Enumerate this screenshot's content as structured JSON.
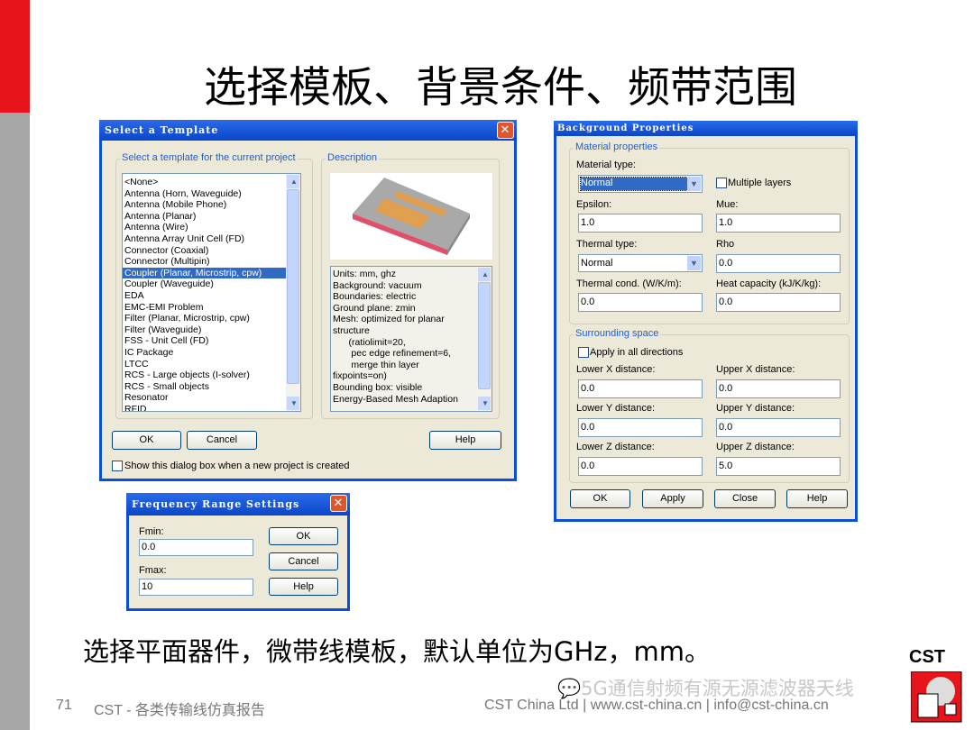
{
  "slide": {
    "title": "选择模板、背景条件、频带范围",
    "subtitle": "选择平面器件，微带线模板，默认单位为GHz，mm。",
    "page_number": "71",
    "footer_left": "CST - 各类传输线仿真报告",
    "footer_right": "CST China Ltd | www.cst-china.cn | info@cst-china.cn",
    "watermark": "5G通信射频有源无源滤波器天线",
    "logo": "CST",
    "accent_red": "#e8141c",
    "side_grey": "#a6a6a6"
  },
  "template_dialog": {
    "title": "Select a Template",
    "list_group": "Select a template for the current project",
    "items": [
      "<None>",
      "Antenna (Horn, Waveguide)",
      "Antenna (Mobile Phone)",
      "Antenna (Planar)",
      "Antenna (Wire)",
      "Antenna Array Unit Cell (FD)",
      "Connector (Coaxial)",
      "Connector (Multipin)",
      "Coupler (Planar, Microstrip, cpw)",
      "Coupler (Waveguide)",
      "EDA",
      "EMC-EMI Problem",
      "Filter (Planar, Microstrip, cpw)",
      "Filter (Waveguide)",
      "FSS - Unit Cell (FD)",
      "IC Package",
      "LTCC",
      "RCS - Large objects (I-solver)",
      "RCS - Small objects",
      "Resonator",
      "RFID"
    ],
    "selected": "Coupler (Planar, Microstrip, cpw)",
    "description_group": "Description",
    "description_lines": [
      "Units: mm, ghz",
      "Background: vacuum",
      "Boundaries: electric",
      "Ground plane: zmin",
      "Mesh: optimized for planar",
      "structure",
      "      (ratiolimit=20,",
      "       pec edge refinement=6,",
      "       merge thin layer",
      "fixpoints=on)",
      "Bounding box: visible",
      "Energy-Based Mesh Adaption"
    ],
    "ok": "OK",
    "cancel": "Cancel",
    "help": "Help",
    "show_checkbox": "Show this dialog box when a new project is created",
    "show_checked": false
  },
  "background_dialog": {
    "title": "Background Properties",
    "material_group": "Material properties",
    "material_type_label": "Material type:",
    "material_type": "Normal",
    "multiple_layers": "Multiple layers",
    "epsilon_label": "Epsilon:",
    "epsilon": "1.0",
    "mue_label": "Mue:",
    "mue": "1.0",
    "thermal_type_label": "Thermal type:",
    "thermal_type": "Normal",
    "rho_label": "Rho",
    "rho": "0.0",
    "thermal_cond_label": "Thermal cond. (W/K/m):",
    "thermal_cond": "0.0",
    "heat_cap_label": "Heat capacity (kJ/K/kg):",
    "heat_cap": "0.0",
    "surrounding_group": "Surrounding space",
    "apply_all": "Apply in all directions",
    "lower_x_label": "Lower X distance:",
    "lower_x": "0.0",
    "upper_x_label": "Upper X distance:",
    "upper_x": "0.0",
    "lower_y_label": "Lower Y distance:",
    "lower_y": "0.0",
    "upper_y_label": "Upper Y distance:",
    "upper_y": "0.0",
    "lower_z_label": "Lower Z distance:",
    "lower_z": "0.0",
    "upper_z_label": "Upper Z distance:",
    "upper_z": "5.0",
    "ok": "OK",
    "apply": "Apply",
    "close": "Close",
    "help": "Help"
  },
  "frequency_dialog": {
    "title": "Frequency Range Settings",
    "fmin_label": "Fmin:",
    "fmin": "0.0",
    "fmax_label": "Fmax:",
    "fmax": "10",
    "ok": "OK",
    "cancel": "Cancel",
    "help": "Help"
  }
}
